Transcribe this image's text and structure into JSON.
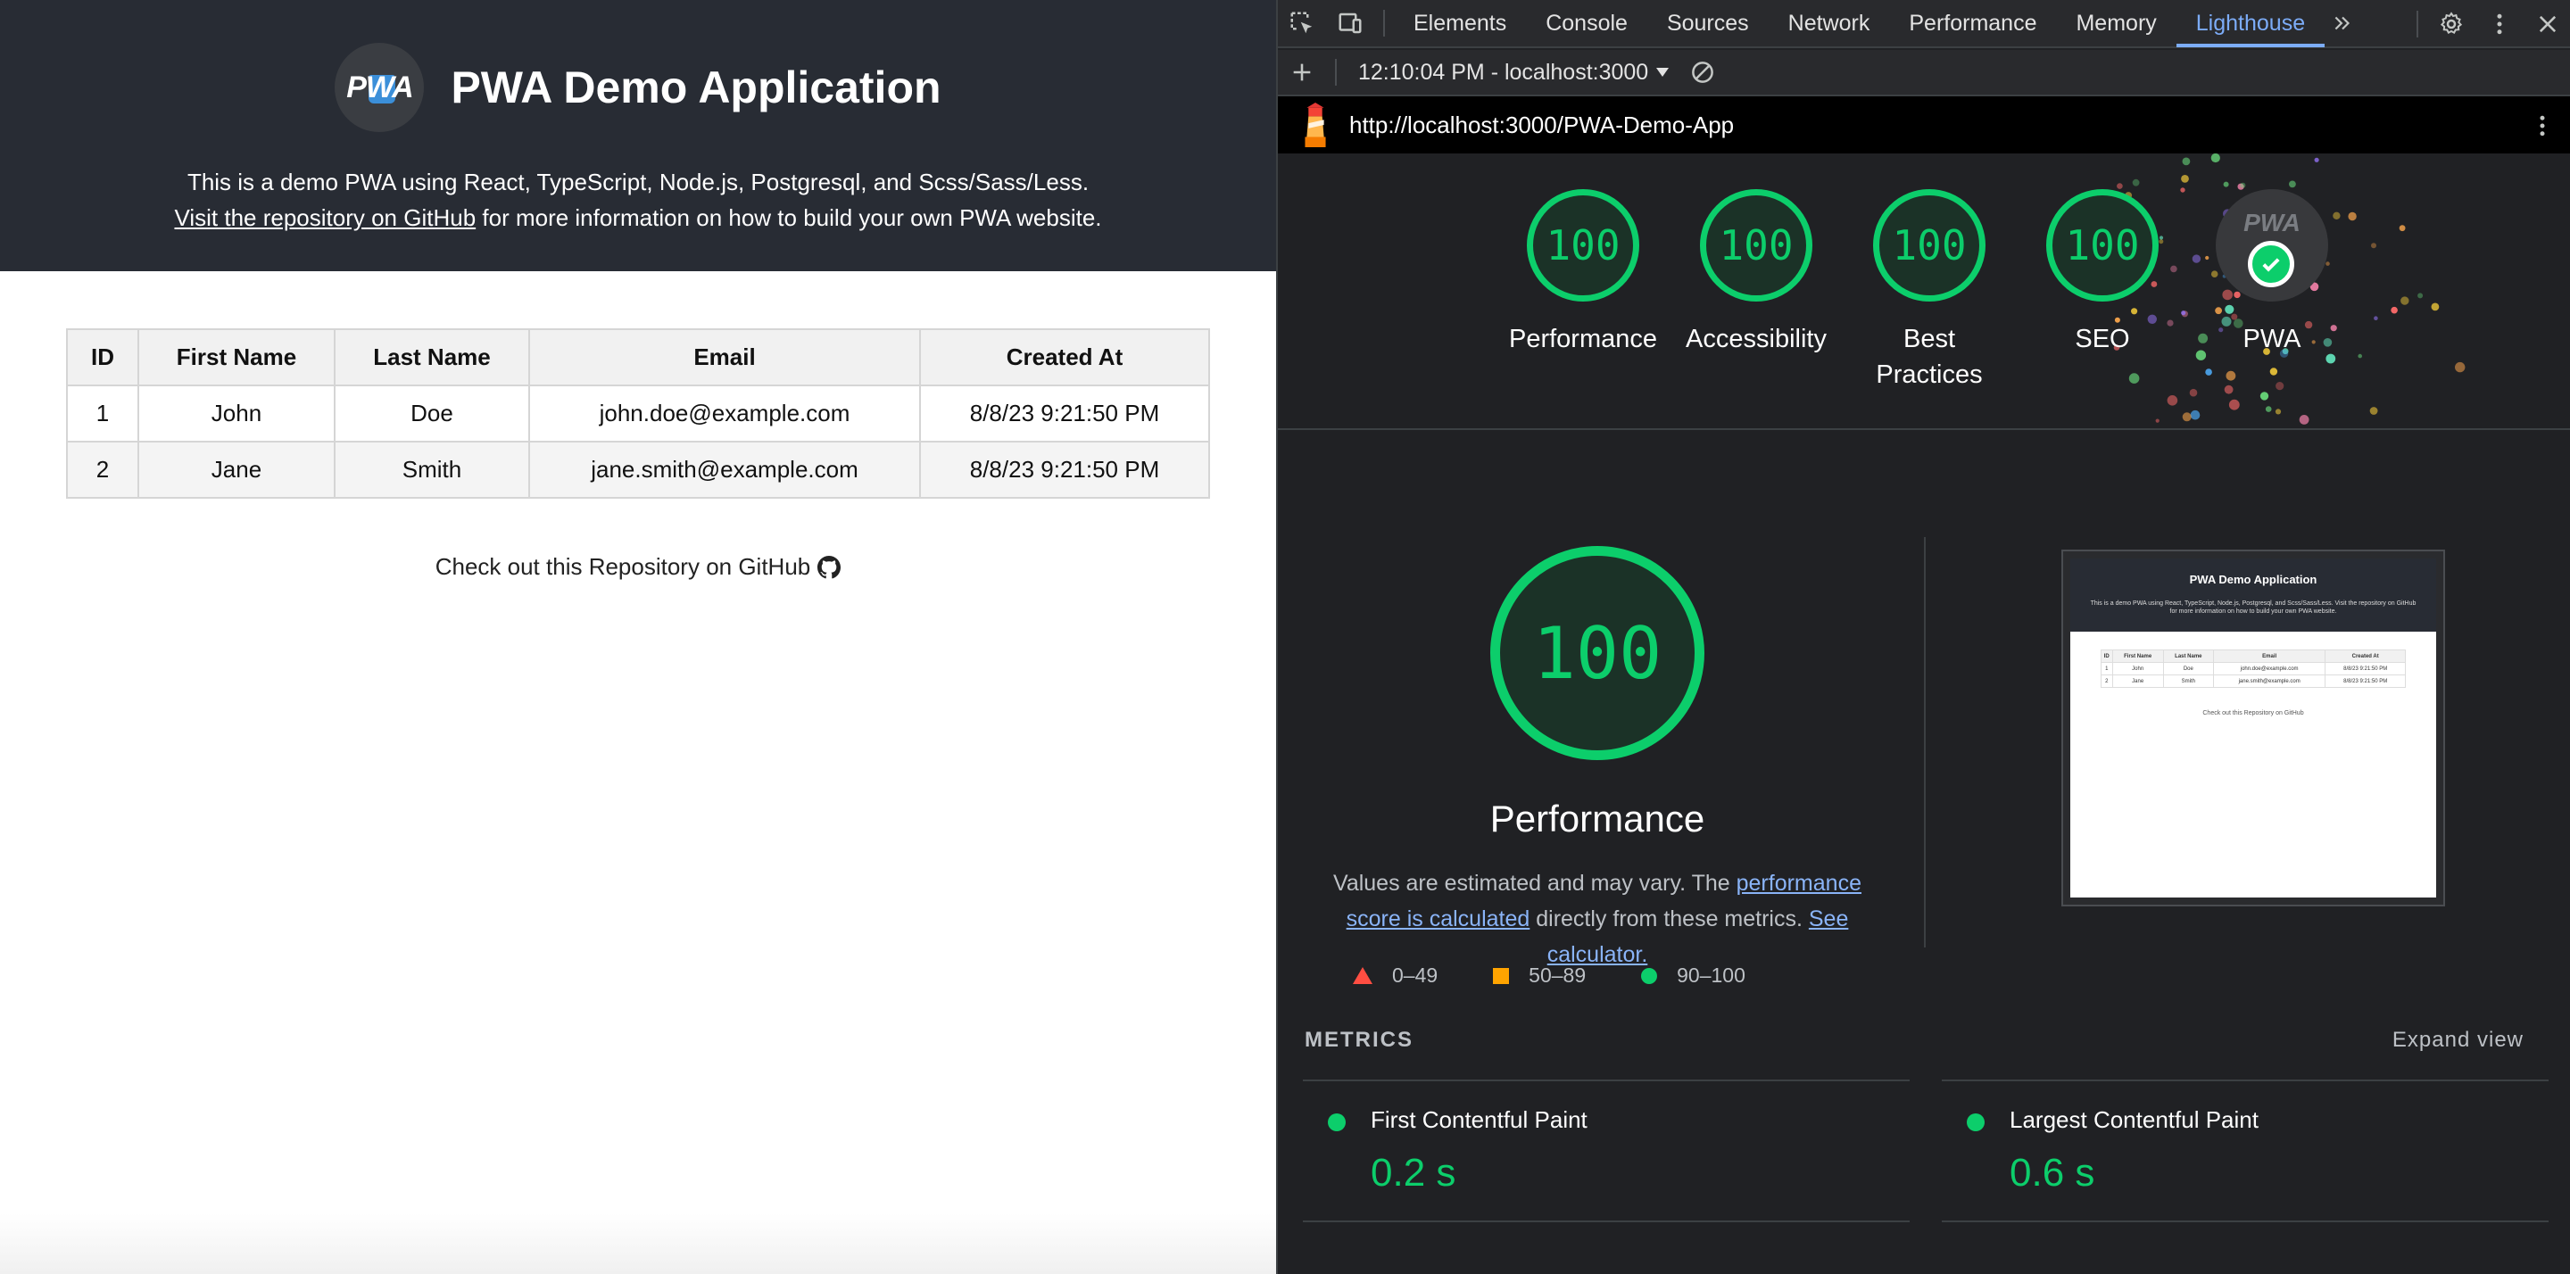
{
  "app": {
    "logo_text": "PWA",
    "title": "PWA Demo Application",
    "description_line1": "This is a demo PWA using React, TypeScript, Node.js, Postgresql, and Scss/Sass/Less.",
    "repo_link_text": "Visit the repository on GitHub",
    "description_line2_rest": " for more information on how to build your own PWA website.",
    "table": {
      "headers": [
        "ID",
        "First Name",
        "Last Name",
        "Email",
        "Created At"
      ],
      "rows": [
        [
          "1",
          "John",
          "Doe",
          "john.doe@example.com",
          "8/8/23 9:21:50 PM"
        ],
        [
          "2",
          "Jane",
          "Smith",
          "jane.smith@example.com",
          "8/8/23 9:21:50 PM"
        ]
      ]
    },
    "footer_link": "Check out this Repository on GitHub"
  },
  "devtools": {
    "tabs": [
      "Elements",
      "Console",
      "Sources",
      "Network",
      "Performance",
      "Memory",
      "Lighthouse"
    ],
    "active_tab": "Lighthouse",
    "report_select": "12:10:04 PM - localhost:3000",
    "url": "http://localhost:3000/PWA-Demo-App"
  },
  "lighthouse": {
    "gauges": [
      {
        "label": "Performance",
        "score": "100"
      },
      {
        "label": "Accessibility",
        "score": "100"
      },
      {
        "label": "Best Practices",
        "score": "100"
      },
      {
        "label": "SEO",
        "score": "100"
      }
    ],
    "pwa": {
      "label": "PWA",
      "badge_text": "PWA"
    },
    "big_score": "100",
    "big_title": "Performance",
    "note_prefix": "Values are estimated and may vary. The ",
    "note_link1": "performance score is calculated",
    "note_middle": " directly from these metrics. ",
    "note_link2": "See calculator.",
    "legend": [
      "0–49",
      "50–89",
      "90–100"
    ],
    "metrics_title": "METRICS",
    "expand_view": "Expand view",
    "metrics": [
      {
        "name": "First Contentful Paint",
        "value": "0.2 s"
      },
      {
        "name": "Largest Contentful Paint",
        "value": "0.6 s"
      }
    ],
    "thumbnail": {
      "title": "PWA Demo Application",
      "desc": "This is a demo PWA using React, TypeScript, Node.js, Postgresql, and Scss/Sass/Less. Visit the repository on GitHub for more information on how to build your own PWA website.",
      "headers": [
        "ID",
        "First Name",
        "Last Name",
        "Email",
        "Created At"
      ],
      "rows": [
        [
          "1",
          "John",
          "Doe",
          "john.doe@example.com",
          "8/8/23 9:21:50 PM"
        ],
        [
          "2",
          "Jane",
          "Smith",
          "jane.smith@example.com",
          "8/8/23 9:21:50 PM"
        ]
      ],
      "footer": "Check out this Repository on GitHub"
    }
  },
  "colors": {
    "pass": "#0cce6b",
    "average": "#ffa400",
    "fail": "#ff4e42",
    "link": "#8ab4f8",
    "header_bg": "#282c34"
  }
}
